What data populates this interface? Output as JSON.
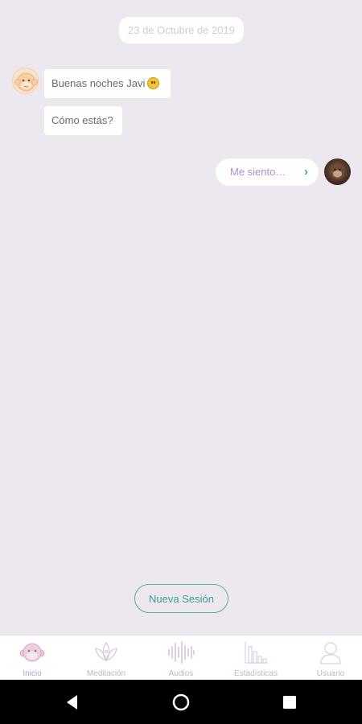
{
  "chat": {
    "date": "23 de Octubre de 2019",
    "bot_messages": [
      {
        "text": "Buenas noches Javi",
        "emoji": "grinning-face"
      },
      {
        "text": "Cómo estás?"
      }
    ],
    "user_reply": {
      "text": "Me siento…",
      "arrow": "›"
    }
  },
  "actions": {
    "new_session": "Nueva Sesión"
  },
  "tabs": [
    {
      "label": "Inicio",
      "icon": "monkey-face-icon"
    },
    {
      "label": "Meditación",
      "icon": "lotus-icon"
    },
    {
      "label": "Audios",
      "icon": "waveform-icon"
    },
    {
      "label": "Estadísticas",
      "icon": "bar-chart-icon"
    },
    {
      "label": "Usuario",
      "icon": "user-icon"
    }
  ],
  "colors": {
    "background": "#ede7ef",
    "accent_teal": "#3f9f94",
    "accent_lilac": "#b48cc8"
  }
}
